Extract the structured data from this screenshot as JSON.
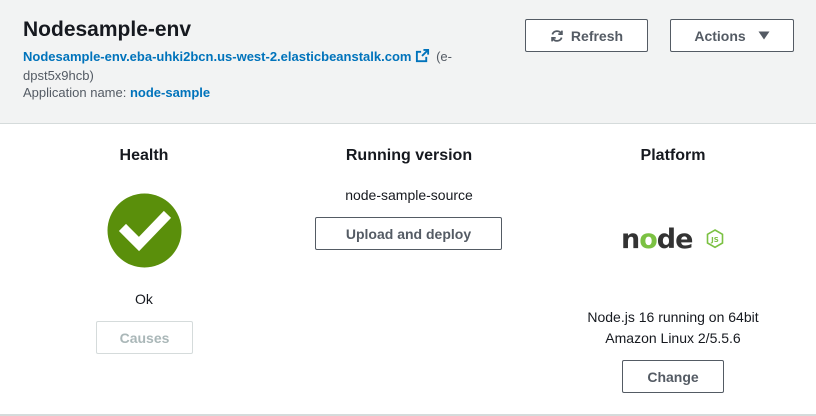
{
  "header": {
    "title": "Nodesample-env",
    "env_url": "Nodesample-env.eba-uhki2bcn.us-west-2.elasticbeanstalk.com",
    "env_id": "(e-dpst5x9hcb)",
    "app_name_label": "Application name:",
    "app_name": "node-sample",
    "refresh_label": "Refresh",
    "actions_label": "Actions"
  },
  "health": {
    "heading": "Health",
    "status": "Ok",
    "status_color": "#5a8f0b",
    "causes_label": "Causes"
  },
  "running_version": {
    "heading": "Running version",
    "version": "node-sample-source",
    "upload_label": "Upload and deploy"
  },
  "platform": {
    "heading": "Platform",
    "logo_text": "node",
    "logo_badge": "JS",
    "description_line1": "Node.js 16 running on 64bit",
    "description_line2": "Amazon Linux 2/5.5.6",
    "change_label": "Change"
  },
  "colors": {
    "link": "#0073bb",
    "header_bg": "#f2f3f3",
    "node_green": "#7bc142",
    "node_dark": "#333333"
  },
  "icons": {
    "refresh": "refresh-icon",
    "actions_caret": "caret-down-icon",
    "external_link": "external-link-icon",
    "health": "check-circle-icon"
  }
}
